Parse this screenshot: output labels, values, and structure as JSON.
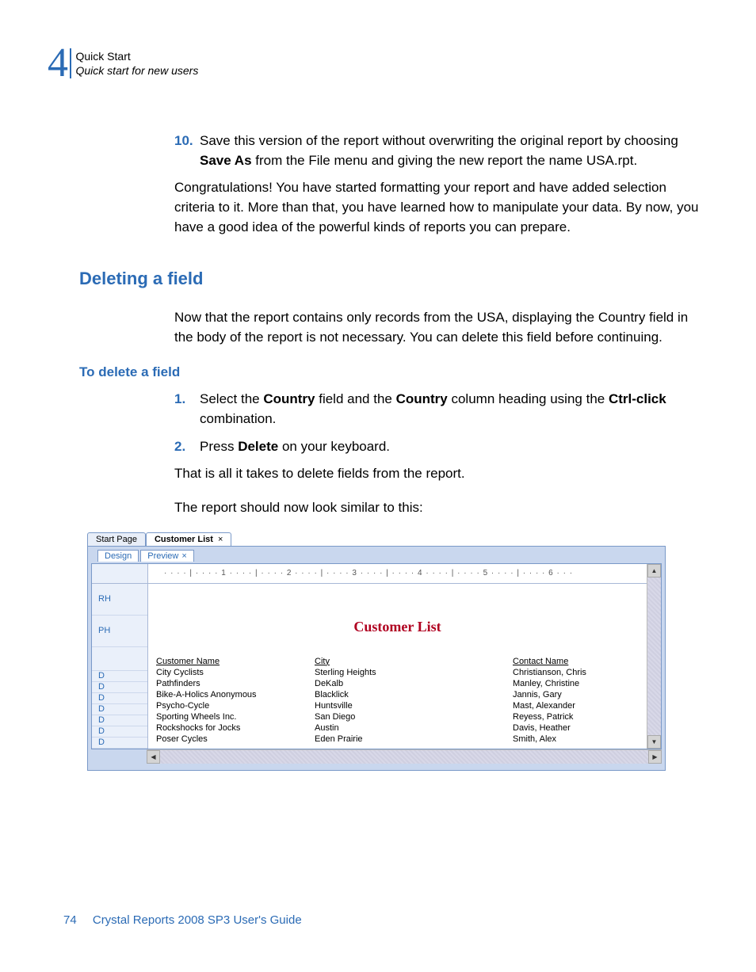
{
  "chapter": {
    "number": "4",
    "title": "Quick Start",
    "subtitle": "Quick start for new users"
  },
  "step10": {
    "num": "10.",
    "text_a": "Save this version of the report without overwriting the original report by choosing ",
    "bold_a": "Save As",
    "text_b": " from the File menu and giving the new report the name USA.rpt."
  },
  "congrats": "Congratulations! You have started formatting your report and have added selection criteria to it. More than that, you have learned how to manipulate your data. By now, you have a good idea of the powerful kinds of reports you can prepare.",
  "h2": "Deleting a field",
  "delete_intro": "Now that the report contains only records from the USA, displaying the Country field in the body of the report is not necessary. You can delete this field before continuing.",
  "h3": "To delete a field",
  "step1": {
    "num": "1.",
    "a": "Select the ",
    "b": "Country",
    "c": " field and the ",
    "d": "Country",
    "e": " column heading using the ",
    "f": "Ctrl-click",
    "g": " combination."
  },
  "step2": {
    "num": "2.",
    "a": "Press ",
    "b": "Delete",
    "c": " on your keyboard."
  },
  "after1": "That is all it takes to delete fields from the report.",
  "after2": "The report should now look similar to this:",
  "screenshot": {
    "outer_tabs": {
      "start": "Start Page",
      "doc": "Customer List",
      "close": "×"
    },
    "inner_tabs": {
      "design": "Design",
      "preview": "Preview",
      "close": "×"
    },
    "ruler": "· · · · | · · · · 1 · · · · | · · · · 2 · · · · | · · · · 3 · · · · | · · · · 4 · · · · | · · · · 5 · · · · | · · · · 6 · · ·",
    "sections": {
      "rh": "RH",
      "ph": "PH",
      "d": "D"
    },
    "title": "Customer List",
    "headers": {
      "a": "Customer Name",
      "b": "City",
      "c": "Contact Name"
    },
    "rows": [
      {
        "a": "City Cyclists",
        "b": "Sterling Heights",
        "c": "Christianson, Chris"
      },
      {
        "a": "Pathfinders",
        "b": "DeKalb",
        "c": "Manley, Christine"
      },
      {
        "a": "Bike-A-Holics Anonymous",
        "b": "Blacklick",
        "c": "Jannis, Gary"
      },
      {
        "a": "Psycho-Cycle",
        "b": "Huntsville",
        "c": "Mast, Alexander"
      },
      {
        "a": "Sporting Wheels Inc.",
        "b": "San Diego",
        "c": "Reyess, Patrick"
      },
      {
        "a": "Rockshocks for Jocks",
        "b": "Austin",
        "c": "Davis, Heather"
      },
      {
        "a": "Poser Cycles",
        "b": "Eden Prairie",
        "c": "Smith, Alex"
      }
    ],
    "arrows": {
      "up": "▲",
      "down": "▼",
      "left": "◀",
      "right": "▶"
    }
  },
  "footer": {
    "page": "74",
    "book": "Crystal Reports 2008 SP3 User's Guide"
  }
}
